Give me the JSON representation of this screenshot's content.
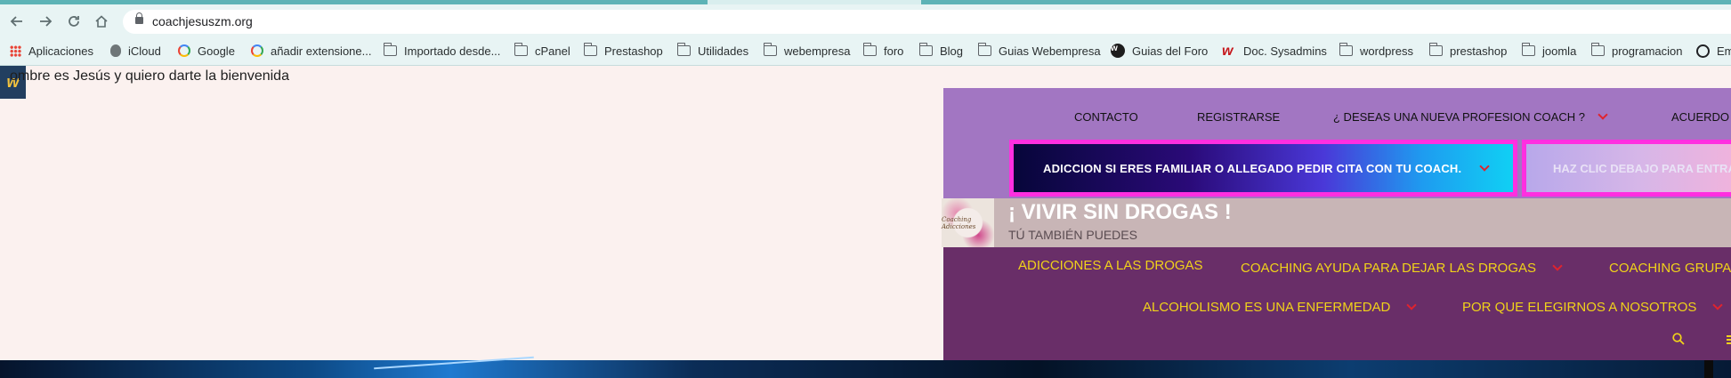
{
  "browser": {
    "url": "coachjesuszm.org",
    "bookmarks": [
      {
        "label": "Aplicaciones",
        "icon": "apps-grid-icon"
      },
      {
        "label": "iCloud",
        "icon": "apple-icon"
      },
      {
        "label": "Google",
        "icon": "google-icon"
      },
      {
        "label": "añadir extensione...",
        "icon": "google-icon"
      },
      {
        "label": "Importado desde...",
        "icon": "folder-icon"
      },
      {
        "label": "cPanel",
        "icon": "folder-icon"
      },
      {
        "label": "Prestashop",
        "icon": "folder-icon"
      },
      {
        "label": "Utilidades",
        "icon": "folder-icon"
      },
      {
        "label": "webempresa",
        "icon": "folder-icon"
      },
      {
        "label": "foro",
        "icon": "folder-icon"
      },
      {
        "label": "Blog",
        "icon": "folder-icon"
      },
      {
        "label": "Guias Webempresa",
        "icon": "folder-icon"
      },
      {
        "label": "Guias del Foro",
        "icon": "webempresa-icon"
      },
      {
        "label": "Doc. Sysadmins",
        "icon": "webempresa-red-icon"
      },
      {
        "label": "wordpress",
        "icon": "folder-icon"
      },
      {
        "label": "prestashop",
        "icon": "folder-icon"
      },
      {
        "label": "joomla",
        "icon": "folder-icon"
      },
      {
        "label": "programacion",
        "icon": "folder-icon"
      },
      {
        "label": "Em",
        "icon": "globe-icon"
      }
    ]
  },
  "page": {
    "badge": "w",
    "welcome": "ombre es Jesús y quiero darte la bienvenida"
  },
  "header": {
    "top_nav": [
      {
        "label": "CONTACTO"
      },
      {
        "label": "REGISTRARSE"
      },
      {
        "label": "¿ DESEAS UNA NUEVA PROFESION COACH ?"
      },
      {
        "label": "ACUERDO"
      }
    ],
    "cta_primary": "ADICCION SI ERES FAMILIAR O ALLEGADO PEDIR CITA CON TU COACH.",
    "cta_secondary": "HAZ CLIC DEBAJO PARA ENTRA",
    "logo_text": "Coaching Adicciones",
    "site_title": "¡ VIVIR SIN DROGAS !",
    "tagline": "TÚ TAMBIÉN PUEDES",
    "main_menu": [
      {
        "label": "ADICCIONES A LAS DROGAS"
      },
      {
        "label": "COACHING AYUDA PARA DEJAR LAS DROGAS"
      },
      {
        "label": "COACHING GRUPAL"
      },
      {
        "label": "ALCOHOLISMO ES UNA ENFERMEDAD"
      },
      {
        "label": "POR QUE ELEGIRNOS A NOSOTROS"
      }
    ]
  },
  "colors": {
    "topbar": "#a276c2",
    "cta_border": "#ff2fe0",
    "menu_bg": "#692e68",
    "menu_text": "#f0d21a",
    "chevron": "#e0232e",
    "brand_bar": "#c8b5b6"
  }
}
